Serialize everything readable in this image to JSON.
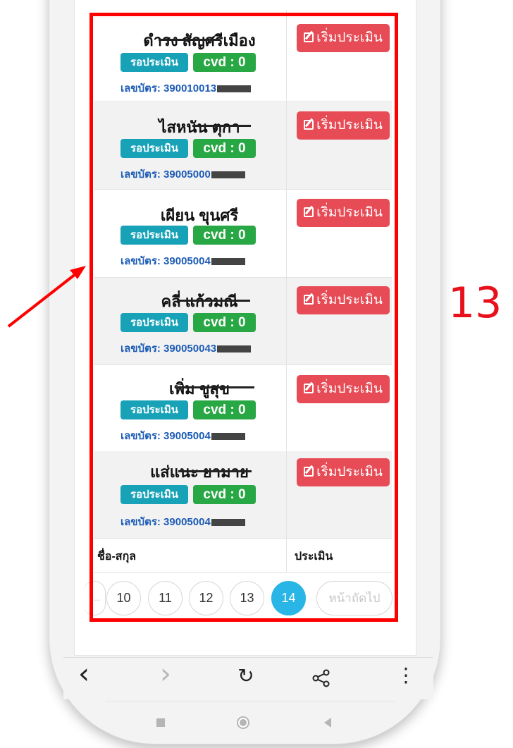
{
  "rows": [
    {
      "name": "ดำรง สัญศรีเมือง",
      "status": "รอประเมิน",
      "cvd": "cvd : 0",
      "id_prefix": "เลขบัตร: 390010013",
      "button": "เริ่มประเมิน"
    },
    {
      "name": "ไสหนัน ตุกา",
      "status": "รอประเมิน",
      "cvd": "cvd : 0",
      "id_prefix": "เลขบัตร: 39005000",
      "button": "เริ่มประเมิน"
    },
    {
      "name": "เผียน ขุนศรี",
      "status": "รอประเมิน",
      "cvd": "cvd : 0",
      "id_prefix": "เลขบัตร: 39005004",
      "button": "เริ่มประเมิน"
    },
    {
      "name": "คลี่ แก้วมณี",
      "status": "รอประเมิน",
      "cvd": "cvd : 0",
      "id_prefix": "เลขบัตร: 390050043",
      "button": "เริ่มประเมิน"
    },
    {
      "name": "เพิ่ม ชูสุข",
      "status": "รอประเมิน",
      "cvd": "cvd : 0",
      "id_prefix": "เลขบัตร: 39005004",
      "button": "เริ่มประเมิน"
    },
    {
      "name": "แส่แนะ ยามาย",
      "status": "รอประเมิน",
      "cvd": "cvd : 0",
      "id_prefix": "เลขบัตร: 39005004",
      "button": "เริ่มประเมิน"
    }
  ],
  "table_header": {
    "name_col": "ชื่อ-สกุล",
    "action_col": "ประเมิน"
  },
  "pagination": {
    "dots": "...",
    "pages": [
      "10",
      "11",
      "12",
      "13",
      "14"
    ],
    "active": "14",
    "next": "หน้าถัดไป"
  },
  "annotation": {
    "number": "13"
  },
  "browser_toolbar": {
    "back": "‹",
    "forward": "›",
    "reload": "↻",
    "share": "share",
    "menu": "⋮"
  },
  "colors": {
    "highlight": "#ff0000",
    "waiting_badge": "#17a2b8",
    "cvd_badge": "#28a745",
    "start_button": "#e64b56",
    "active_page": "#29b6e6"
  }
}
